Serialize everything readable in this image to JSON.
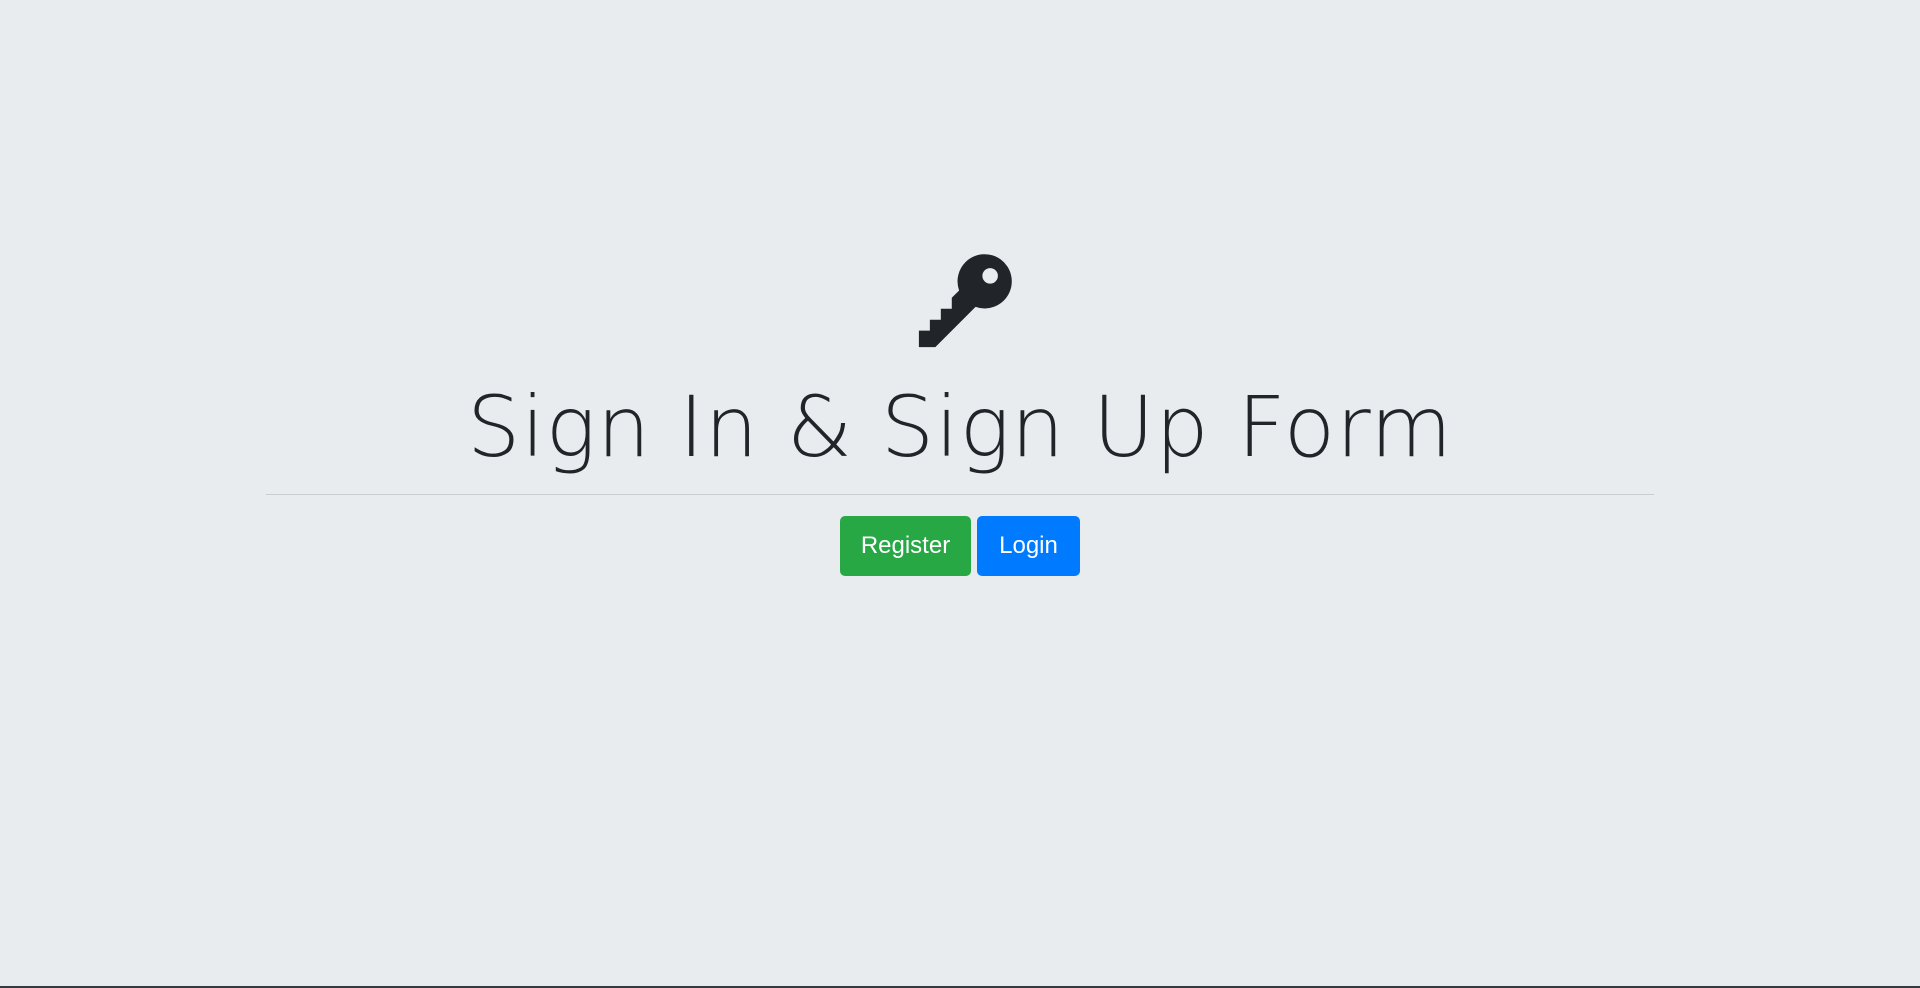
{
  "page": {
    "title": "Sign In & Sign Up Form"
  },
  "hero": {
    "icon": "key-icon",
    "title": "Sign In & Sign Up Form",
    "buttons": {
      "register_label": "Register",
      "login_label": "Login"
    }
  },
  "colors": {
    "background": "#e9ecef",
    "text": "#212529",
    "register": "#28a745",
    "login": "#007bff"
  }
}
